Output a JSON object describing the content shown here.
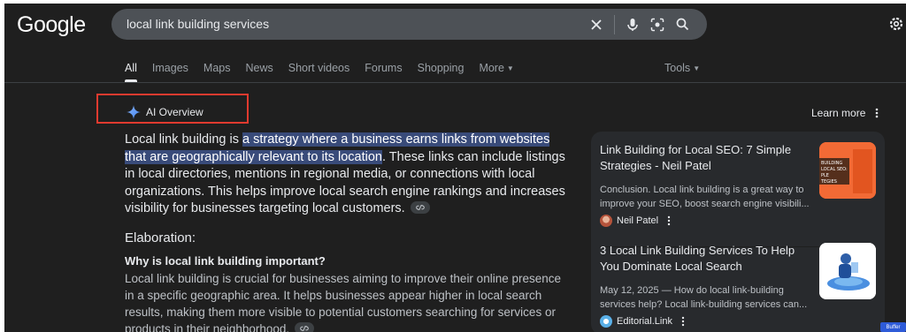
{
  "header": {
    "logo": "Google",
    "search": {
      "value": "local link building services"
    },
    "icons": [
      "close-icon",
      "mic-icon",
      "lens-icon",
      "search-icon",
      "settings-icon"
    ]
  },
  "tabs": [
    {
      "label": "All",
      "active": true
    },
    {
      "label": "Images"
    },
    {
      "label": "Maps"
    },
    {
      "label": "News"
    },
    {
      "label": "Short videos"
    },
    {
      "label": "Forums"
    },
    {
      "label": "Shopping"
    },
    {
      "label": "More"
    }
  ],
  "tools_label": "Tools",
  "ai_overview": {
    "label": "AI Overview",
    "learn_more": "Learn more",
    "intro_before": "Local link building is ",
    "intro_highlight": "a strategy where a business earns links from websites that are geographically relevant to its location",
    "intro_after": ". These links can include listings in local directories, mentions in regional media, or connections with local organizations. This helps improve local search engine rankings and increases visibility for businesses targeting local customers.",
    "elaboration_heading": "Elaboration:",
    "subheading": "Why is local link building important?",
    "sub_text": "Local link building is crucial for businesses aiming to improve their online presence in a specific geographic area. It helps businesses appear higher in local search results, making them more visible to potential customers searching for services or products in their neighborhood."
  },
  "sources": [
    {
      "title": "Link Building for Local SEO: 7 Simple Strategies - Neil Patel",
      "snippet": "Conclusion. Local link building is a great way to improve your SEO, boost search engine visibili...",
      "site": "Neil Patel",
      "thumb_text": "BUILDING\nLOCAL SEO:\nPLE\nTEGIES"
    },
    {
      "title": "3 Local Link Building Services To Help You Dominate Local Search",
      "snippet": "May 12, 2025 — How do local link-building services help? Local link-building services can...",
      "site": "Editorial.Link"
    }
  ],
  "badge": "Buffer",
  "colors": {
    "background": "#1f1f1f",
    "highlight": "#394b7a",
    "annotation_box": "#e03a2f",
    "panel": "#282a2d"
  }
}
